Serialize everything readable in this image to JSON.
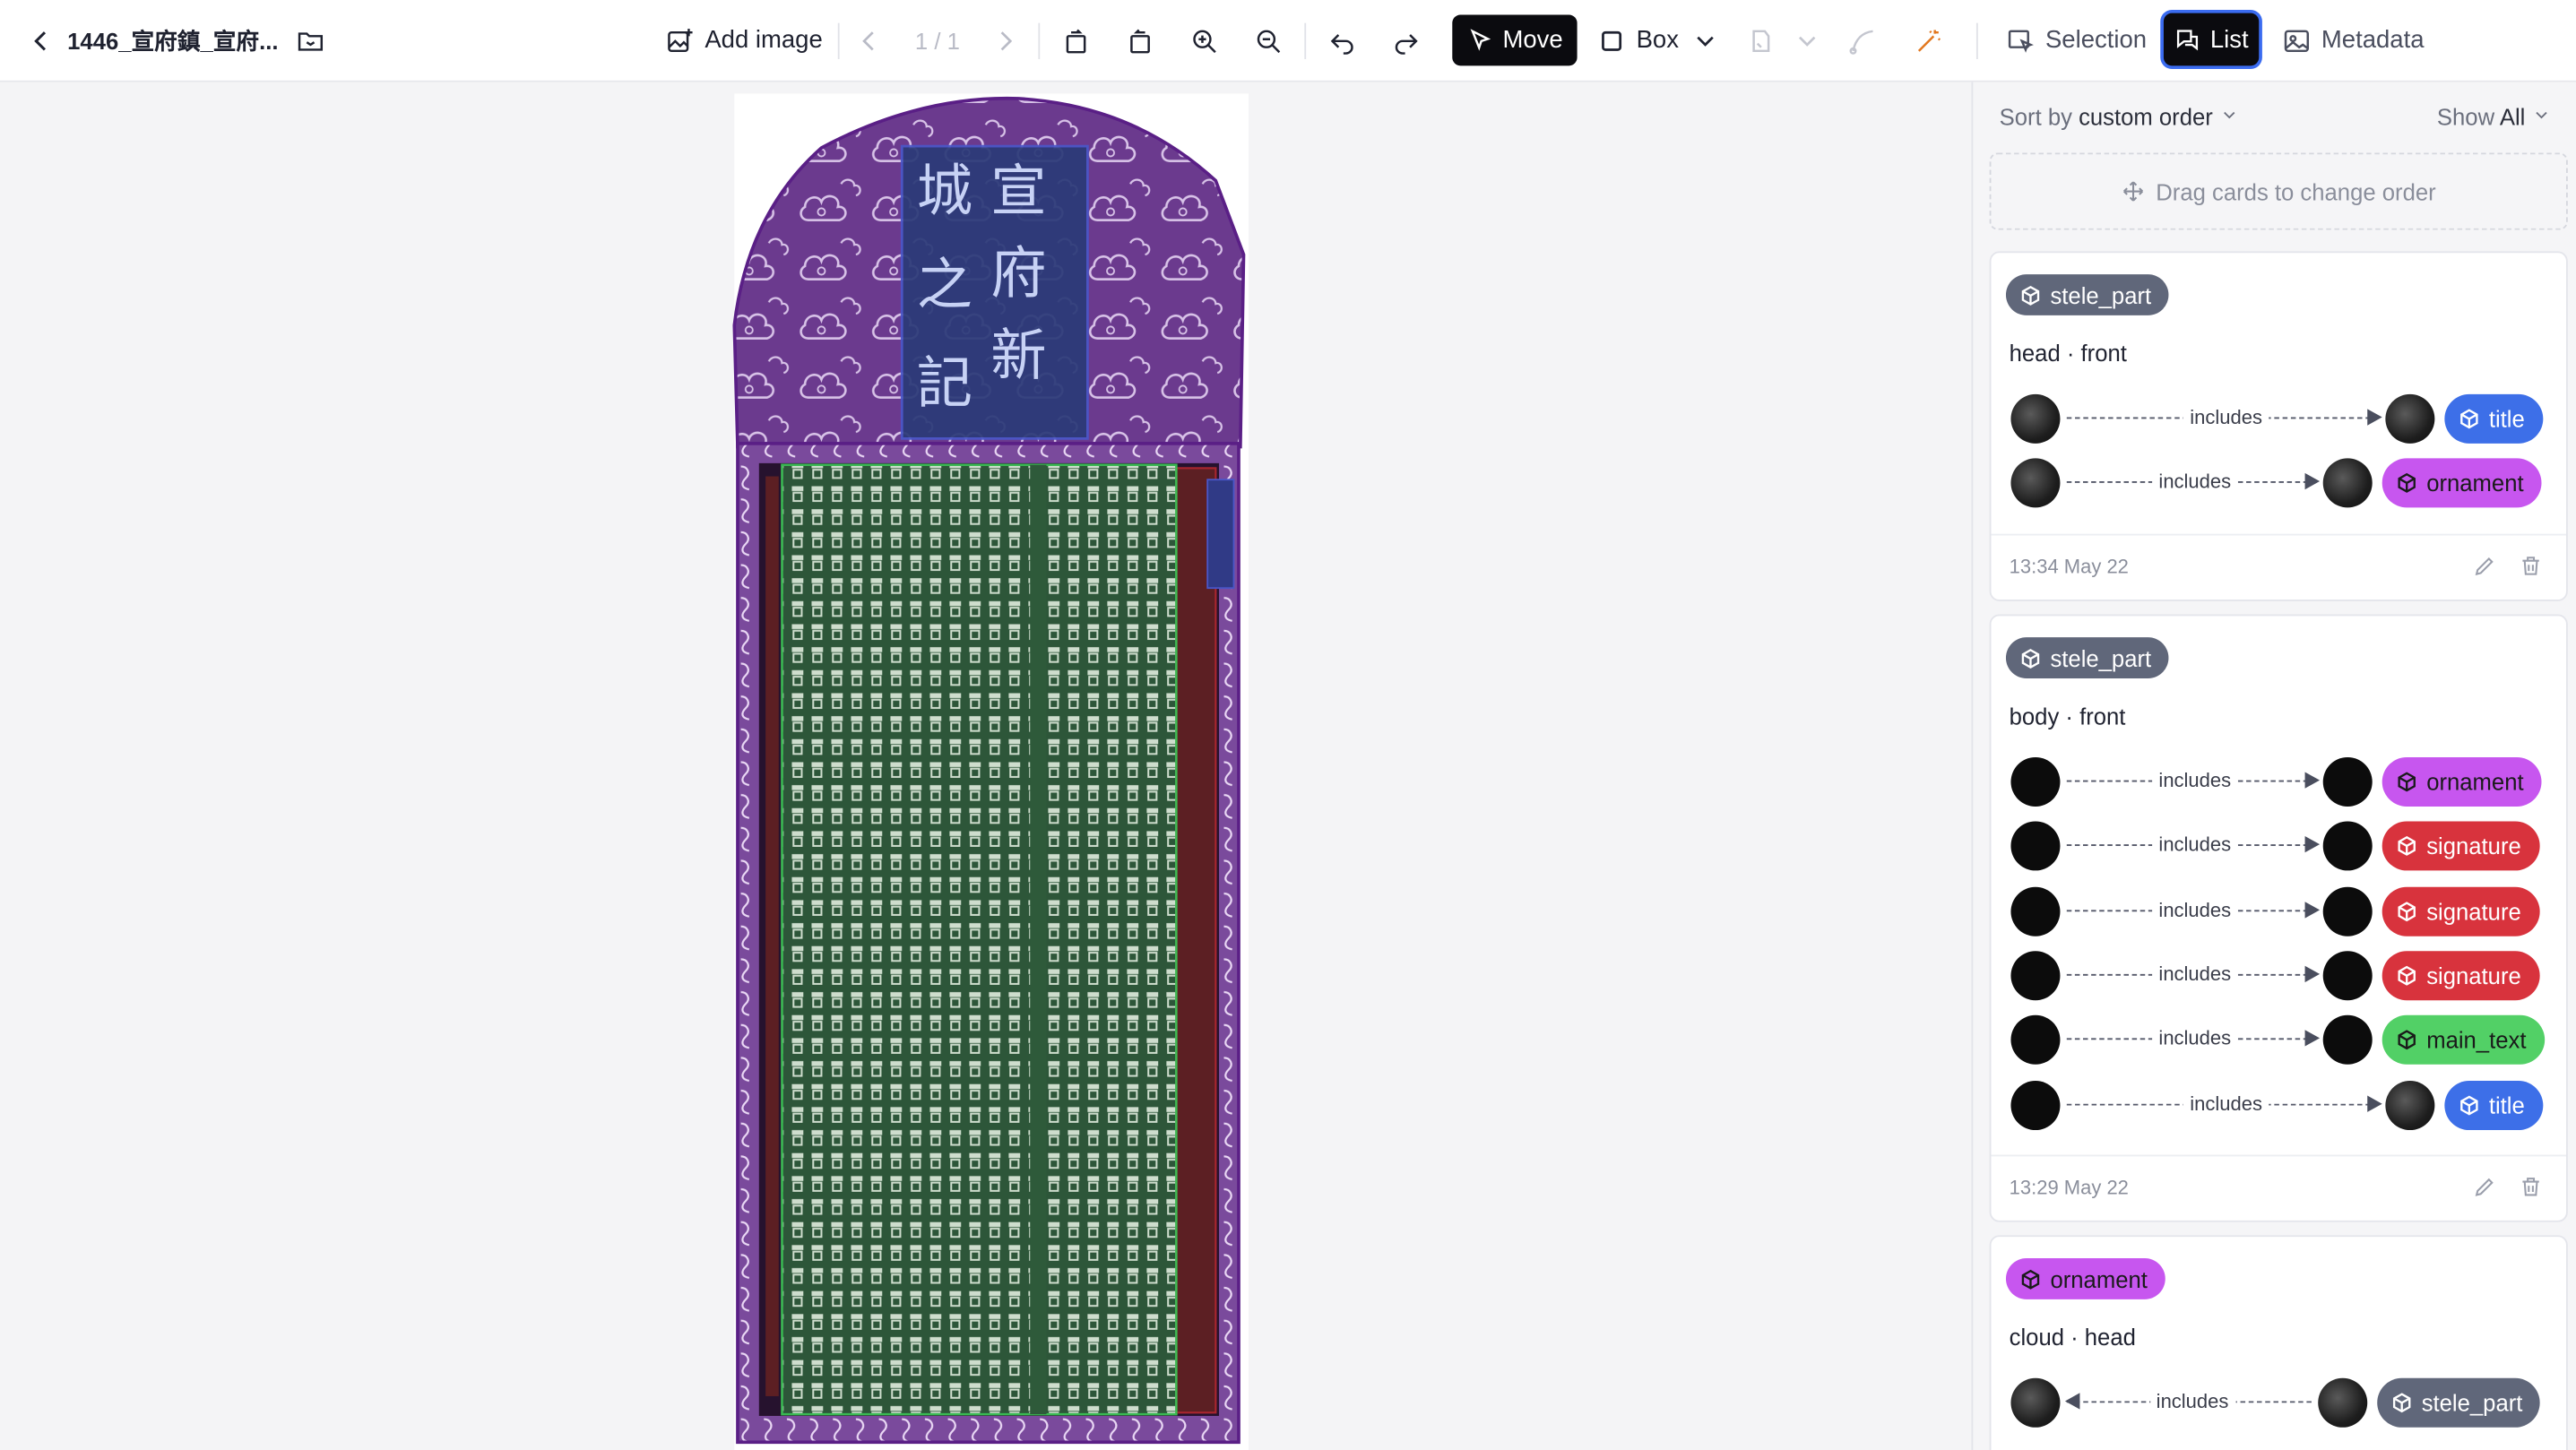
{
  "app": {
    "doc_title": "1446_宣府鎮_宣府...",
    "toolbar": {
      "add_image": "Add image",
      "page_indicator": "1 / 1",
      "move_label": "Move",
      "box_label": "Box",
      "selection_label": "Selection",
      "list_label": "List",
      "metadata_label": "Metadata"
    }
  },
  "panel": {
    "sort_prefix": "Sort by",
    "sort_value": "custom order",
    "show_prefix": "Show",
    "show_value": "All",
    "drag_hint": "Drag cards to change order",
    "cards": [
      {
        "type": "stele_part",
        "subtitle": "head · front",
        "relations": [
          {
            "label": "includes",
            "target": "title",
            "color": "#3d6fe8"
          },
          {
            "label": "includes",
            "target": "ornament",
            "color": "#c756ef"
          }
        ],
        "timestamp": "13:34 May 22"
      },
      {
        "type": "stele_part",
        "subtitle": "body · front",
        "relations": [
          {
            "label": "includes",
            "target": "ornament",
            "color": "#c756ef"
          },
          {
            "label": "includes",
            "target": "signature",
            "color": "#d8333d"
          },
          {
            "label": "includes",
            "target": "signature",
            "color": "#d8333d"
          },
          {
            "label": "includes",
            "target": "signature",
            "color": "#d8333d"
          },
          {
            "label": "includes",
            "target": "main_text",
            "color": "#52d066"
          },
          {
            "label": "includes",
            "target": "title",
            "color": "#3d6fe8"
          }
        ],
        "timestamp": "13:29 May 22"
      },
      {
        "type": "ornament",
        "subtitle": "cloud · head",
        "relations": [
          {
            "label": "includes",
            "target": "stele_part",
            "color": "#60677a"
          }
        ],
        "timestamp": ""
      }
    ]
  },
  "stele": {
    "title_glyphs": "宣府新城記"
  },
  "colors": {
    "accent": "#3b6cf0",
    "stele_part": "#60677a",
    "title": "#3d6fe8",
    "ornament": "#c756ef",
    "signature": "#d8333d",
    "main_text": "#52d066"
  }
}
